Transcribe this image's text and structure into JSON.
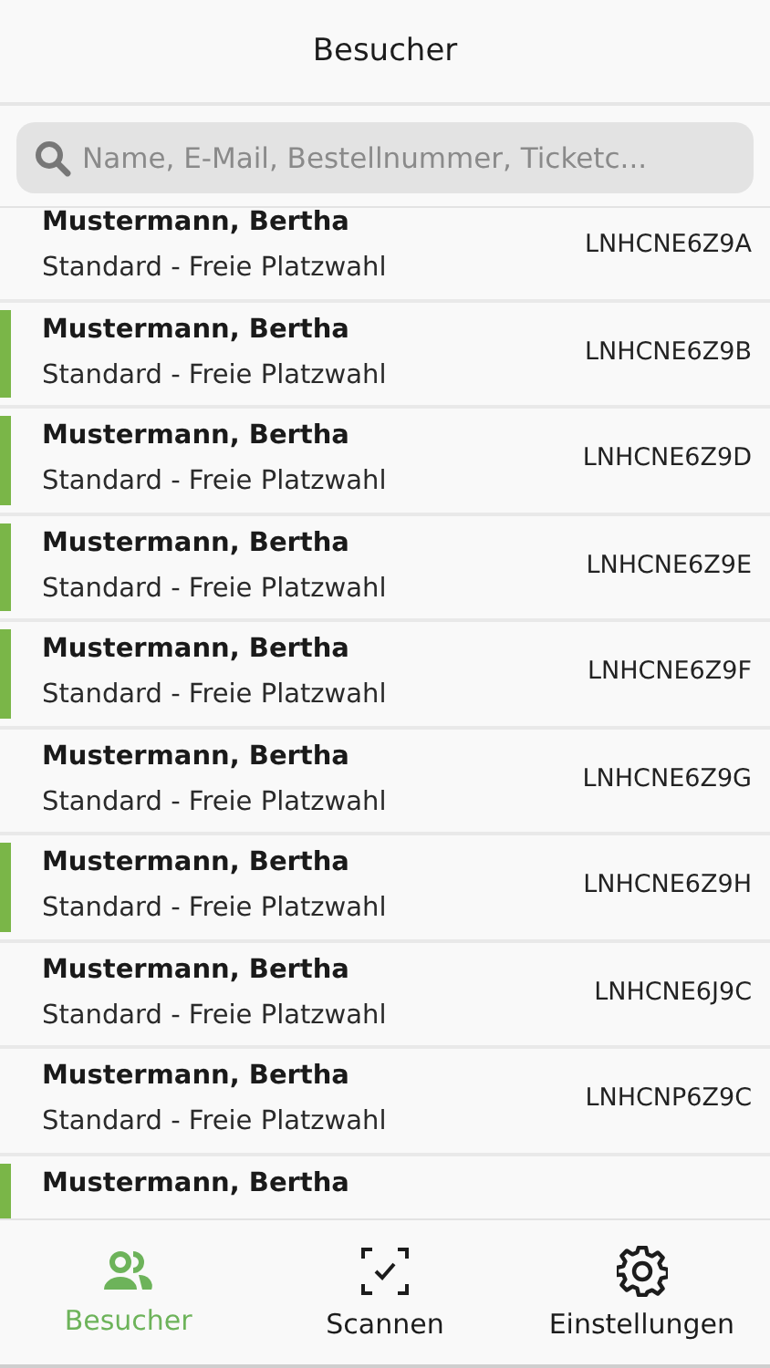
{
  "header": {
    "title": "Besucher"
  },
  "search": {
    "placeholder": "Name, E-Mail, Bestellnummer, Ticketc..."
  },
  "visitors": [
    {
      "name": "Mustermann, Bertha",
      "ticket": "Standard - Freie Platzwahl",
      "code": "LNHCNE6Z9A",
      "checked_in": false
    },
    {
      "name": "Mustermann, Bertha",
      "ticket": "Standard - Freie Platzwahl",
      "code": "LNHCNE6Z9B",
      "checked_in": true
    },
    {
      "name": "Mustermann, Bertha",
      "ticket": "Standard - Freie Platzwahl",
      "code": "LNHCNE6Z9D",
      "checked_in": true
    },
    {
      "name": "Mustermann, Bertha",
      "ticket": "Standard - Freie Platzwahl",
      "code": "LNHCNE6Z9E",
      "checked_in": true
    },
    {
      "name": "Mustermann, Bertha",
      "ticket": "Standard - Freie Platzwahl",
      "code": "LNHCNE6Z9F",
      "checked_in": true
    },
    {
      "name": "Mustermann, Bertha",
      "ticket": "Standard - Freie Platzwahl",
      "code": "LNHCNE6Z9G",
      "checked_in": false
    },
    {
      "name": "Mustermann, Bertha",
      "ticket": "Standard - Freie Platzwahl",
      "code": "LNHCNE6Z9H",
      "checked_in": true
    },
    {
      "name": "Mustermann, Bertha",
      "ticket": "Standard - Freie Platzwahl",
      "code": "LNHCNE6J9C",
      "checked_in": false
    },
    {
      "name": "Mustermann, Bertha",
      "ticket": "Standard - Freie Platzwahl",
      "code": "LNHCNP6Z9C",
      "checked_in": false
    },
    {
      "name": "Mustermann, Bertha",
      "checked_in": true
    }
  ],
  "tabs": [
    {
      "kind": "visitors",
      "label": "Besucher",
      "selected": true
    },
    {
      "kind": "scan",
      "label": "Scannen",
      "selected": false
    },
    {
      "kind": "settings",
      "label": "Einstellungen",
      "selected": false
    }
  ]
}
